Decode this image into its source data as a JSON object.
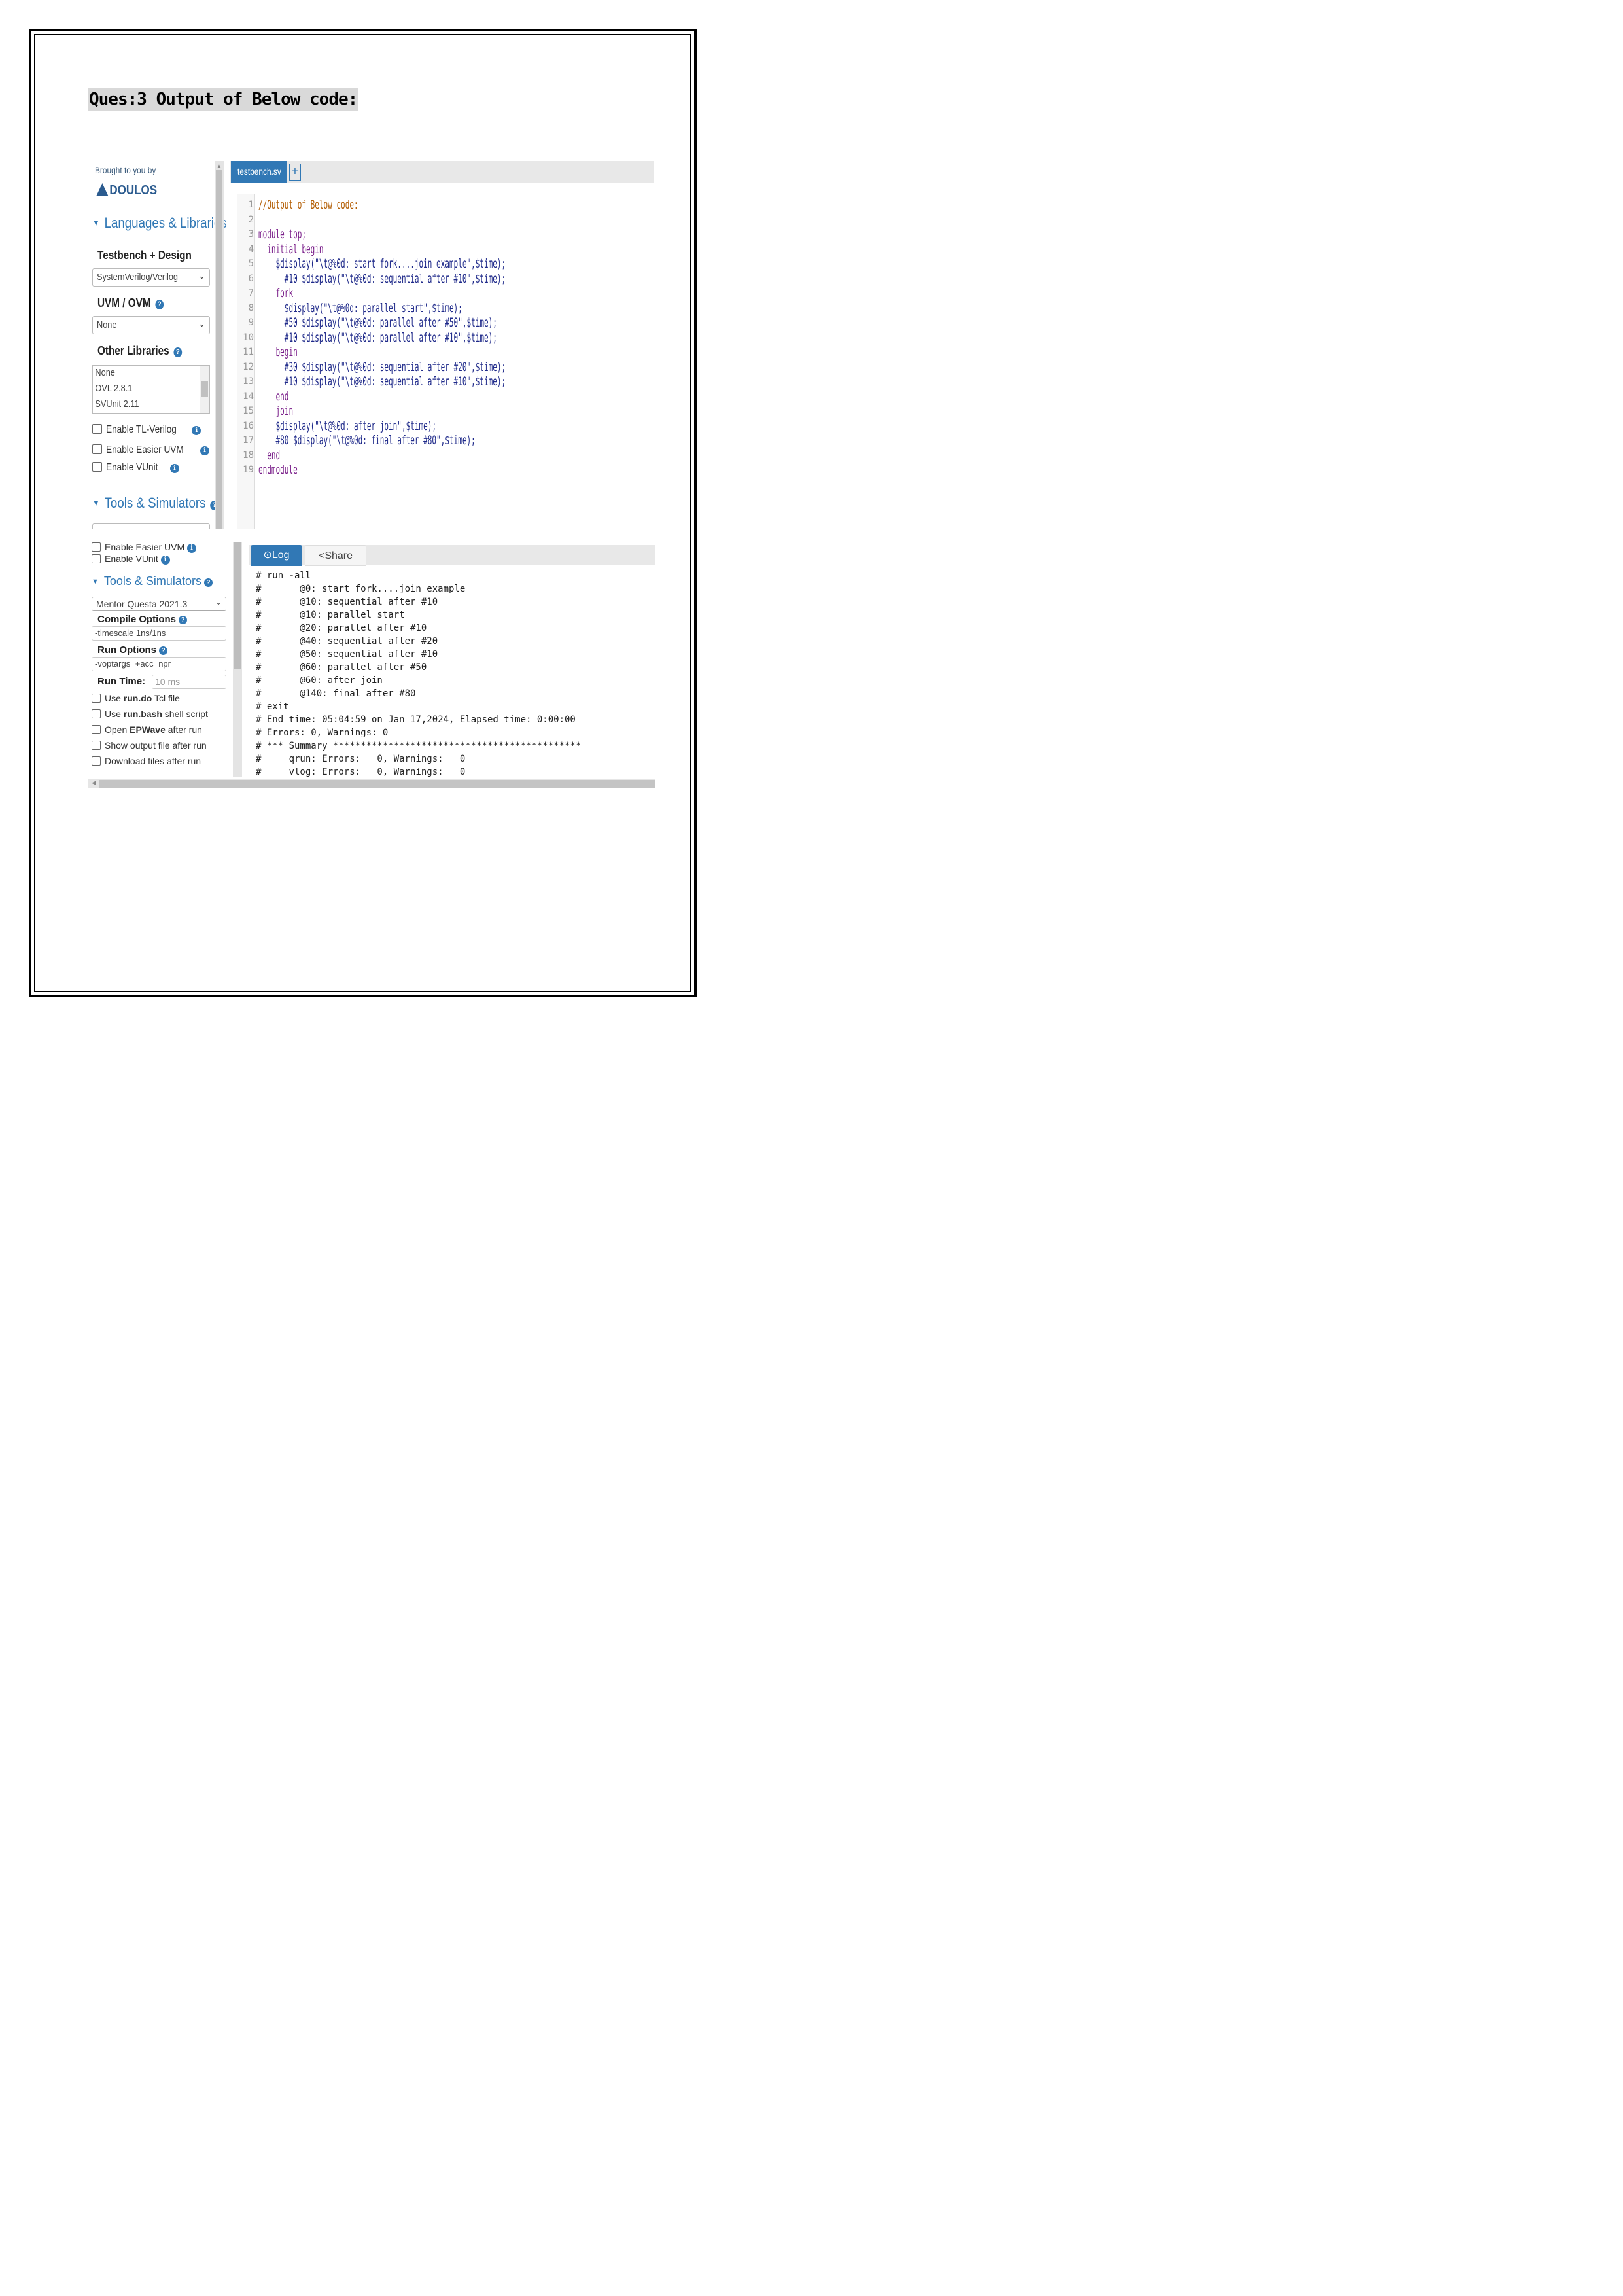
{
  "question": "Ques:3 Output of Below code:",
  "top_screenshot": {
    "sidebar": {
      "brought_by": "Brought to you by",
      "logo_text": "DOULOS",
      "section_languages": "Languages & Libraries",
      "testbench_design_label": "Testbench + Design",
      "language_select": "SystemVerilog/Verilog",
      "uvm_label": "UVM / OVM",
      "uvm_select": "None",
      "other_libraries_label": "Other Libraries",
      "libraries": [
        "None",
        "OVL 2.8.1",
        "SVUnit 2.11"
      ],
      "checkboxes": [
        "Enable TL-Verilog",
        "Enable Easier UVM",
        "Enable VUnit"
      ],
      "section_tools": "Tools & Simulators"
    },
    "editor": {
      "tab_name": "testbench.sv",
      "add_tab": "+",
      "line_numbers": [
        "1",
        "2",
        "3",
        "4",
        "5",
        "6",
        "7",
        "8",
        "9",
        "10",
        "11",
        "12",
        "13",
        "14",
        "15",
        "16",
        "17",
        "18",
        "19"
      ],
      "code_lines": [
        "//Output of Below code:",
        "",
        "module top;",
        "  initial begin",
        "    $display(\"\\t@%0d: start fork....join example\",$time);",
        "      #10 $display(\"\\t@%0d: sequential after #10\",$time);",
        "    fork",
        "      $display(\"\\t@%0d: parallel start\",$time);",
        "      #50 $display(\"\\t@%0d: parallel after #50\",$time);",
        "      #10 $display(\"\\t@%0d: parallel after #10\",$time);",
        "    begin",
        "      #30 $display(\"\\t@%0d: sequential after #20\",$time);",
        "      #10 $display(\"\\t@%0d: sequential after #10\",$time);",
        "    end",
        "    join",
        "    $display(\"\\t@%0d: after join\",$time);",
        "    #80 $display(\"\\t@%0d: final after #80\",$time);",
        "  end",
        "endmodule"
      ]
    }
  },
  "bottom_screenshot": {
    "sidebar": {
      "checkboxes_top": [
        "Enable Easier UVM",
        "Enable VUnit"
      ],
      "section_tools": "Tools & Simulators",
      "simulator_select": "Mentor Questa 2021.3",
      "compile_options_label": "Compile Options",
      "compile_options_value": "-timescale 1ns/1ns",
      "run_options_label": "Run Options",
      "run_options_value": "-voptargs=+acc=npr",
      "run_time_label": "Run Time:",
      "run_time_placeholder": "10 ms",
      "options": [
        {
          "pre": "Use ",
          "bold": "run.do",
          "post": " Tcl file"
        },
        {
          "pre": "Use ",
          "bold": "run.bash",
          "post": " shell script"
        },
        {
          "pre": "Open ",
          "bold": "EPWave",
          "post": " after run"
        },
        {
          "pre": "Show output file after run",
          "bold": "",
          "post": ""
        },
        {
          "pre": "Download files after run",
          "bold": "",
          "post": ""
        }
      ]
    },
    "log": {
      "tab_log": "Log",
      "tab_share": "Share",
      "lines": [
        "# run -all",
        "#       @0: start fork....join example",
        "#       @10: sequential after #10",
        "#       @10: parallel start",
        "#       @20: parallel after #10",
        "#       @40: sequential after #20",
        "#       @50: sequential after #10",
        "#       @60: parallel after #50",
        "#       @60: after join",
        "#       @140: final after #80",
        "# exit",
        "# End time: 05:04:59 on Jan 17,2024, Elapsed time: 0:00:00",
        "# Errors: 0, Warnings: 0",
        "# *** Summary *********************************************",
        "#     qrun: Errors:   0, Warnings:   0",
        "#     vlog: Errors:   0, Warnings:   0"
      ]
    }
  },
  "colors": {
    "accent": "#3178b5",
    "code_keyword": "#7a1f8a",
    "code_string": "#1f2a8a",
    "code_comment": "#b45f06"
  }
}
